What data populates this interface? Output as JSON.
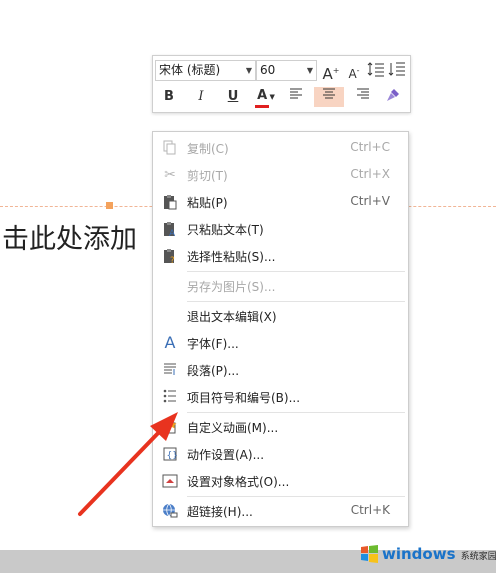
{
  "slide": {
    "title_placeholder": "击此处添加"
  },
  "mini_toolbar": {
    "font_name": "宋体 (标题)",
    "font_size": "60",
    "buttons": {
      "bold": "B",
      "italic": "I",
      "underline": "U",
      "font_color": "A",
      "grow": "A",
      "shrink": "A"
    }
  },
  "context_menu": {
    "items": [
      {
        "label": "复制(C)",
        "shortcut": "Ctrl+C",
        "icon": "copy-icon",
        "enabled": false
      },
      {
        "label": "剪切(T)",
        "shortcut": "Ctrl+X",
        "icon": "cut-icon",
        "enabled": false
      },
      {
        "label": "粘贴(P)",
        "shortcut": "Ctrl+V",
        "icon": "paste-icon",
        "enabled": true
      },
      {
        "label": "只粘贴文本(T)",
        "shortcut": "",
        "icon": "paste-text-icon",
        "enabled": true
      },
      {
        "label": "选择性粘贴(S)...",
        "shortcut": "",
        "icon": "paste-special-icon",
        "enabled": true
      },
      {
        "label": "另存为图片(S)...",
        "shortcut": "",
        "icon": "",
        "enabled": false
      },
      {
        "label": "退出文本编辑(X)",
        "shortcut": "",
        "icon": "",
        "enabled": true
      },
      {
        "label": "字体(F)...",
        "shortcut": "",
        "icon": "font-icon",
        "enabled": true
      },
      {
        "label": "段落(P)...",
        "shortcut": "",
        "icon": "paragraph-icon",
        "enabled": true
      },
      {
        "label": "项目符号和编号(B)...",
        "shortcut": "",
        "icon": "bullets-icon",
        "enabled": true
      },
      {
        "label": "自定义动画(M)...",
        "shortcut": "",
        "icon": "custom-animation-icon",
        "enabled": true
      },
      {
        "label": "动作设置(A)...",
        "shortcut": "",
        "icon": "action-settings-icon",
        "enabled": true
      },
      {
        "label": "设置对象格式(O)...",
        "shortcut": "",
        "icon": "format-object-icon",
        "enabled": true
      },
      {
        "label": "超链接(H)...",
        "shortcut": "Ctrl+K",
        "icon": "hyperlink-icon",
        "enabled": true
      }
    ]
  },
  "colors": {
    "font_color_bar": "#e02020",
    "highlight": "#f8d4c2",
    "annotation_arrow": "#e8331f"
  },
  "watermark": {
    "brand": "windows",
    "suffix": "系统家园"
  }
}
